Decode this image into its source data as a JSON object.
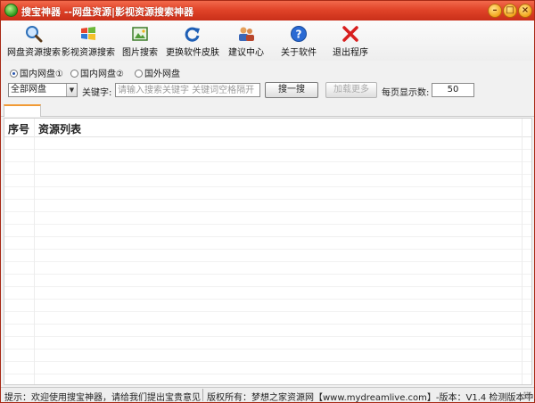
{
  "window": {
    "title": "搜宝神器 --网盘资源|影视资源搜索神器",
    "min_glyph": "–",
    "max_glyph": "□",
    "close_glyph": "×"
  },
  "toolbar": {
    "items": [
      {
        "label": "网盘资源搜索",
        "icon": "magnifier-icon"
      },
      {
        "label": "影视资源搜索",
        "icon": "windows-logo-icon"
      },
      {
        "label": "图片搜索",
        "icon": "image-icon"
      },
      {
        "label": "更换软件皮肤",
        "icon": "refresh-icon"
      },
      {
        "label": "建议中心",
        "icon": "people-icon"
      },
      {
        "label": "关于软件",
        "icon": "help-icon"
      },
      {
        "label": "退出程序",
        "icon": "exit-x-icon"
      }
    ]
  },
  "source_options": [
    {
      "label": "国内网盘①",
      "selected": true
    },
    {
      "label": "国内网盘②",
      "selected": false
    },
    {
      "label": "国外网盘",
      "selected": false
    }
  ],
  "search": {
    "scope_selected": "全部网盘",
    "keyword_label": "关键字:",
    "keyword_placeholder": "请输入搜索关键字 关键词空格隔开",
    "search_button": "搜一搜",
    "load_more_button": "加载更多",
    "per_page_label": "每页显示数:",
    "per_page_value": "50"
  },
  "table": {
    "columns": [
      "序号",
      "资源列表"
    ],
    "rows": []
  },
  "status": {
    "left": "提示：欢迎使用搜宝神器，请给我们提出宝贵意见...",
    "right": "版权所有：梦想之家资源网【www.mydreamlive.com】-版本：V1.4  检测版本中.."
  },
  "colors": {
    "titlebar": "#e14429",
    "tab_accent": "#f19a35",
    "exit_icon": "#d81e1e",
    "help_icon": "#2a6ad4"
  }
}
